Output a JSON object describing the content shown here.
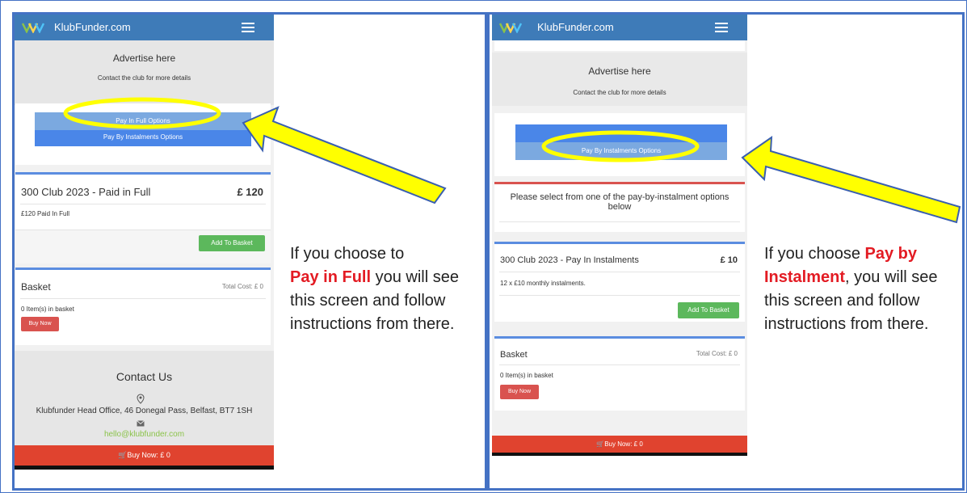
{
  "colors": {
    "topbar": "#3e7bb8",
    "panel_border": "#4472c4",
    "highlight_text": "#e31b23",
    "arrow_fill": "#ffff00",
    "arrow_stroke": "#4472c4"
  },
  "left": {
    "brand": "KlubFunder.com",
    "advertise_title": "Advertise here",
    "advertise_sub": "Contact the club for more details",
    "option_full": "Pay In Full Options",
    "option_instal": "Pay By Instalments Options",
    "item_title": "300 Club 2023 - Paid in Full",
    "item_price": "£ 120",
    "item_desc": "£120 Paid In Full",
    "add_button": "Add To Basket",
    "basket_title": "Basket",
    "basket_total": "Total Cost: £ 0",
    "basket_items": "0 Item(s) in basket",
    "buy_button": "Buy Now",
    "contact_title": "Contact Us",
    "address": "Klubfunder Head Office, 46 Donegal Pass, Belfast, BT7 1SH",
    "email": "hello@klubfunder.com",
    "footer_buy": "Buy Now: £ 0",
    "caption_1": "If you choose to",
    "caption_hl": "Pay in Full",
    "caption_2": " you will see this screen and follow instructions from there."
  },
  "right": {
    "brand": "KlubFunder.com",
    "advertise_title": "Advertise here",
    "advertise_sub": "Contact the club for more details",
    "option_instal": "Pay By Instalments Options",
    "notice": "Please select from one of the pay-by-instalment options below",
    "item_title": "300 Club 2023 - Pay In Instalments",
    "item_price": "£ 10",
    "item_desc": "12 x £10 monthly instalments.",
    "add_button": "Add To Basket",
    "basket_title": "Basket",
    "basket_total": "Total Cost: £ 0",
    "basket_items": "0 Item(s) in basket",
    "buy_button": "Buy Now",
    "footer_buy": "Buy Now: £ 0",
    "caption_1": "If you choose ",
    "caption_hl": "Pay by Instalment",
    "caption_2": ", you will see this screen and follow instructions from there."
  }
}
